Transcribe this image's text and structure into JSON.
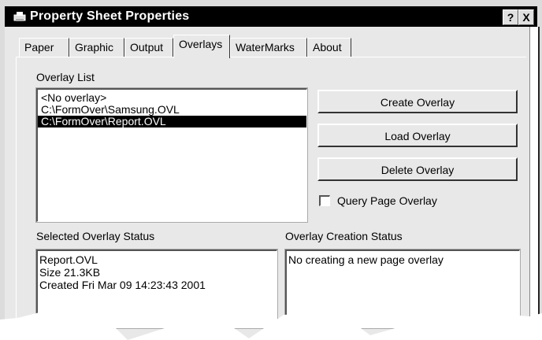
{
  "window": {
    "title": "Property Sheet Properties",
    "help_button": "?",
    "close_button": "X"
  },
  "tabs": [
    {
      "label": "Paper"
    },
    {
      "label": "Graphic"
    },
    {
      "label": "Output"
    },
    {
      "label": "Overlays",
      "active": true
    },
    {
      "label": "WaterMarks"
    },
    {
      "label": "About"
    }
  ],
  "overlay_list": {
    "label": "Overlay List",
    "items": [
      {
        "text": "<No overlay>"
      },
      {
        "text": "C:\\FormOver\\Samsung.OVL"
      },
      {
        "text": "C:\\FormOver\\Report.OVL",
        "selected": true
      }
    ]
  },
  "buttons": {
    "create": "Create Overlay",
    "load": "Load Overlay",
    "delete": "Delete Overlay"
  },
  "query_page_overlay": {
    "label": "Query Page Overlay",
    "checked": false
  },
  "selected_status": {
    "label": "Selected Overlay Status",
    "lines": [
      "Report.OVL",
      "Size 21.3KB",
      "Created Fri Mar 09 14:23:43 2001"
    ]
  },
  "creation_status": {
    "label": "Overlay Creation Status",
    "text": "No creating a new page overlay"
  },
  "colors": {
    "title_bar": "#000000",
    "dialog_bg": "#e8e8e8",
    "selection": "#000000"
  }
}
